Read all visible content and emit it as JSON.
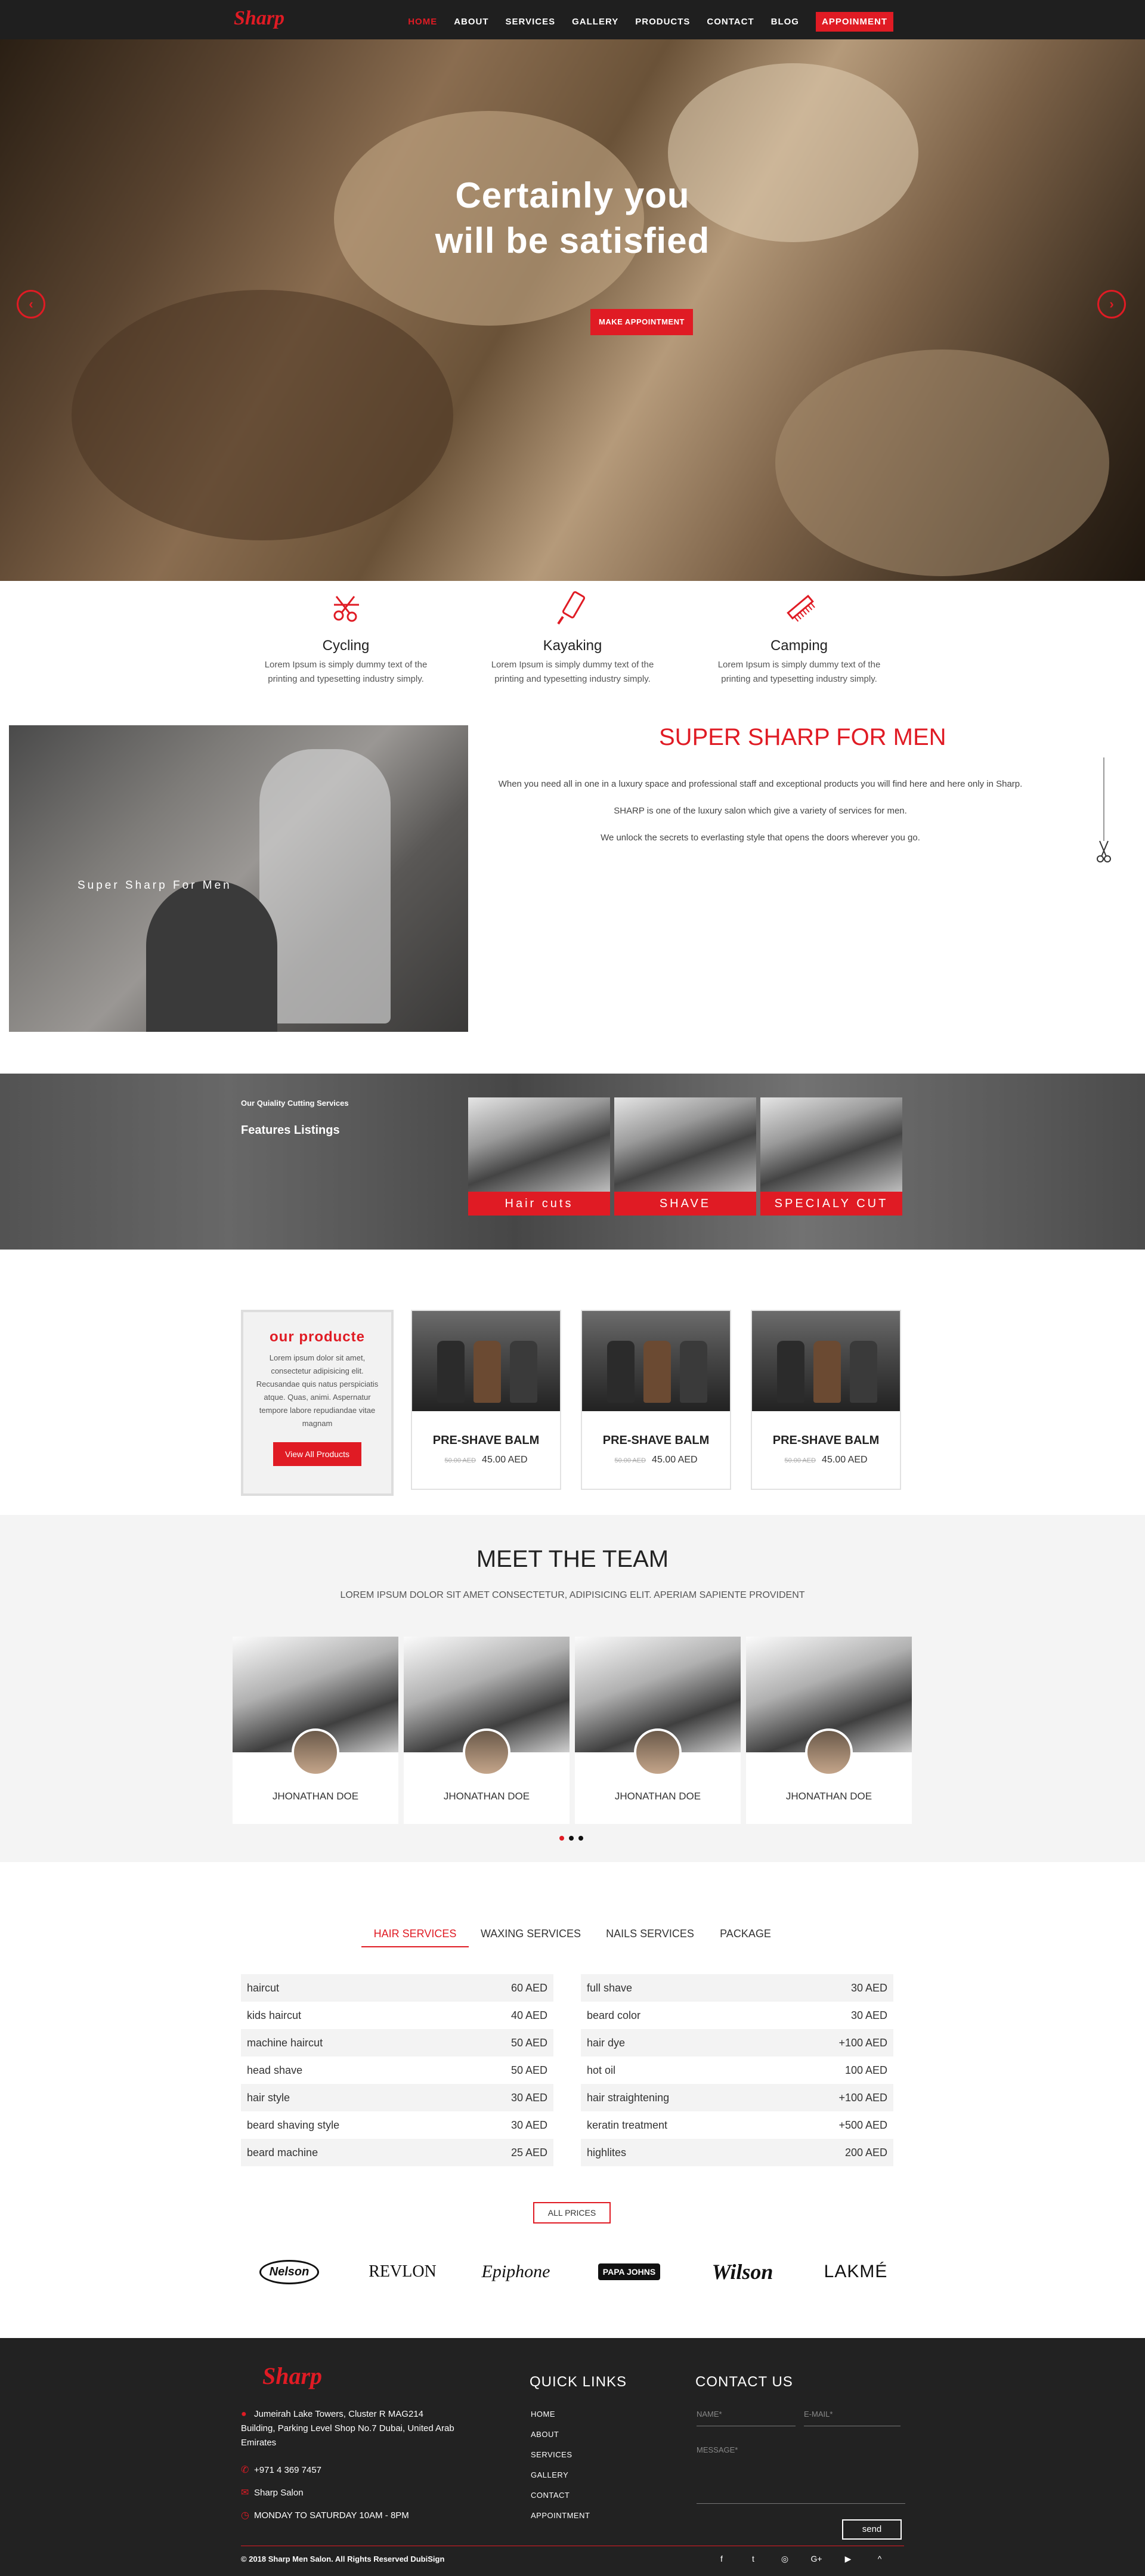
{
  "brand": {
    "logo_text": "Sharp",
    "accent": "#e01b24"
  },
  "nav": {
    "items": [
      "HOME",
      "ABOUT",
      "SERVICES",
      "GALLERY",
      "PRODUCTS",
      "CONTACT",
      "BLOG",
      "APPOINMENT"
    ]
  },
  "hero": {
    "title_line1": "Certainly you",
    "title_line2": "will be satisfied",
    "button": "MAKE APPOINTMENT",
    "prev": "‹",
    "next": "›"
  },
  "features": [
    {
      "icon": "scissors-comb-icon",
      "title": "Cycling",
      "text": "Lorem Ipsum is simply dummy text of the printing and typesetting industry simply."
    },
    {
      "icon": "razor-icon",
      "title": "Kayaking",
      "text": "Lorem Ipsum is simply dummy text of the printing and typesetting industry simply."
    },
    {
      "icon": "comb-icon",
      "title": "Camping",
      "text": "Lorem Ipsum is simply dummy text of the printing and typesetting industry simply."
    }
  ],
  "about": {
    "image_caption": "Super Sharp For Men",
    "title": "SUPER SHARP FOR MEN",
    "p1": "When you need all in one in a luxury space and professional staff and exceptional products you will find here and here only in Sharp.",
    "p2": "SHARP is one of the luxury salon which give a variety of services for men.",
    "p3": "We unlock the secrets to everlasting style that opens the doors wherever you go."
  },
  "listings": {
    "subtitle": "Our Quiality Cutting Services",
    "title": "Features Listings",
    "cards": [
      "Hair cuts",
      "SHAVE",
      "SPECIALY CUT"
    ]
  },
  "products": {
    "intro_title": "our producte",
    "intro_text": "Lorem ipsum dolor sit amet, consectetur adipisicing elit. Recusandae quis natus perspiciatis atque. Quas, animi. Aspernatur tempore labore repudiandae vitae magnam",
    "intro_button": "View All Products",
    "items": [
      {
        "name": "PRE-SHAVE BALM",
        "old_price": "50.00 AED",
        "price": "45.00 AED"
      },
      {
        "name": "PRE-SHAVE BALM",
        "old_price": "50.00 AED",
        "price": "45.00 AED"
      },
      {
        "name": "PRE-SHAVE BALM",
        "old_price": "50.00 AED",
        "price": "45.00 AED"
      }
    ]
  },
  "team": {
    "title": "MEET THE TEAM",
    "subtitle": "LOREM IPSUM DOLOR SIT AMET CONSECTETUR, ADIPISICING ELIT. APERIAM SAPIENTE PROVIDENT",
    "members": [
      "JHONATHAN DOE",
      "JHONATHAN DOE",
      "JHONATHAN DOE",
      "JHONATHAN DOE"
    ],
    "active_dot": 0
  },
  "prices": {
    "tabs": [
      "HAIR SERVICES",
      "WAXING SERVICES",
      "NAILS SERVICES",
      "PACKAGE"
    ],
    "active_tab": 0,
    "left": [
      {
        "name": "haircut",
        "price": "60 AED"
      },
      {
        "name": "kids haircut",
        "price": "40 AED"
      },
      {
        "name": "machine haircut",
        "price": "50 AED"
      },
      {
        "name": "head shave",
        "price": "50 AED"
      },
      {
        "name": "hair style",
        "price": "30 AED"
      },
      {
        "name": "beard shaving style",
        "price": "30 AED"
      },
      {
        "name": "beard machine",
        "price": "25 AED"
      }
    ],
    "right": [
      {
        "name": "full shave",
        "price": "30 AED"
      },
      {
        "name": "beard color",
        "price": "30 AED"
      },
      {
        "name": "hair dye",
        "price": "+100 AED"
      },
      {
        "name": "hot oil",
        "price": "100 AED"
      },
      {
        "name": "hair straightening",
        "price": "+100 AED"
      },
      {
        "name": "keratin treatment",
        "price": "+500 AED"
      },
      {
        "name": "highlites",
        "price": "200 AED"
      }
    ],
    "all_button": "ALL PRICES"
  },
  "brands": [
    "Nelson",
    "REVLON",
    "Epiphone",
    "PAPA JOHNS",
    "Wilson",
    "LAKMÉ"
  ],
  "footer": {
    "address": "Jumeirah Lake Towers, Cluster R MAG214 Building, Parking Level Shop No.7 Dubai, United Arab Emirates",
    "phone": "+971 4 369 7457",
    "email": "Sharp Salon",
    "hours": "MONDAY TO SATURDAY 10AM - 8PM",
    "quick_title": "QUICK LINKS",
    "links": [
      "HOME",
      "ABOUT",
      "SERVICES",
      "GALLERY",
      "CONTACT",
      "APPOINTMENT"
    ],
    "contact_title": "CONTACT US",
    "name_ph": "NAME*",
    "email_ph": "E-MAIL*",
    "message_ph": "MESSAGE*",
    "send": "send",
    "copyright": "© 2018 Sharp Men Salon. All Rights Reserved DubiSign",
    "social": [
      "f",
      "t",
      "◎",
      "G+",
      "▶",
      "^"
    ]
  }
}
